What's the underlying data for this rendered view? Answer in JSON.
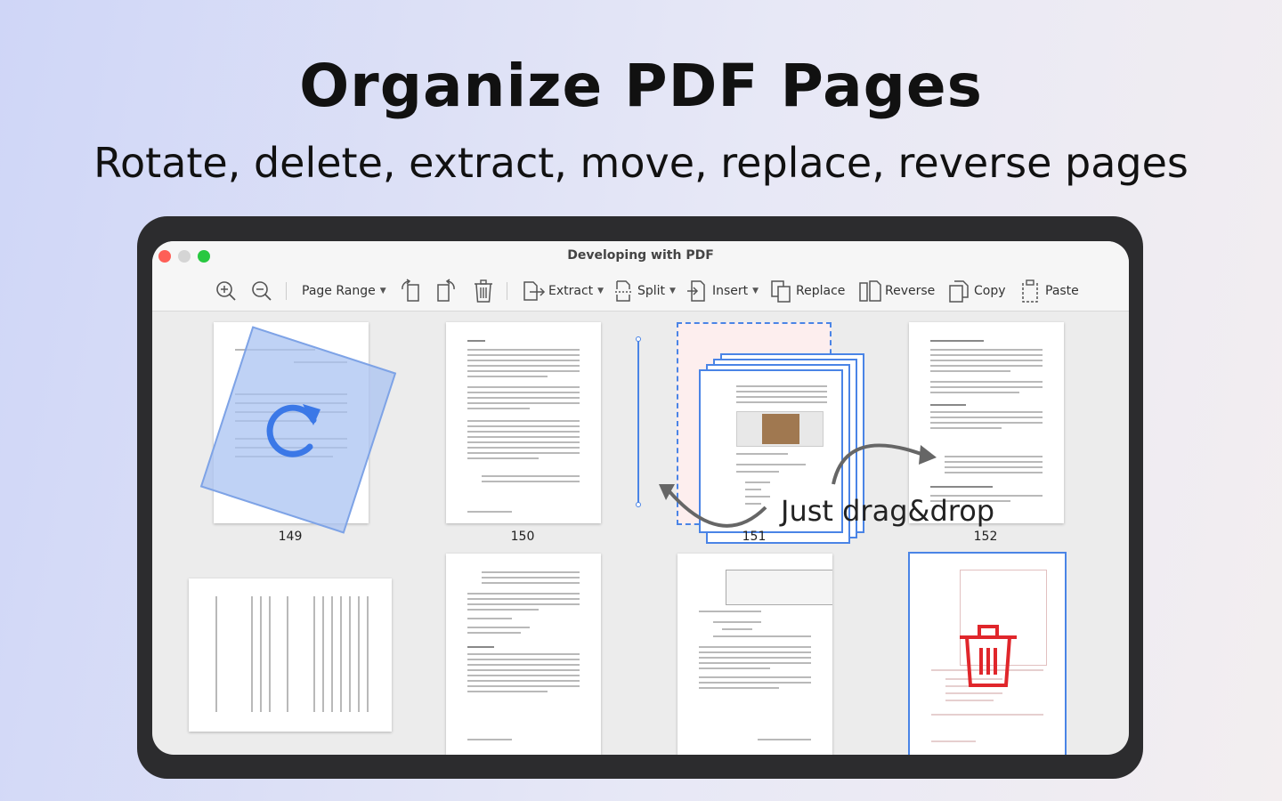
{
  "hero": {
    "title": "Organize PDF Pages",
    "subtitle": "Rotate, delete, extract, move, replace, reverse pages"
  },
  "window": {
    "title": "Developing with PDF"
  },
  "toolbar": {
    "page_range": "Page Range",
    "extract": "Extract",
    "split": "Split",
    "insert": "Insert",
    "replace": "Replace",
    "reverse": "Reverse",
    "copy": "Copy",
    "paste": "Paste"
  },
  "pages": {
    "p149": "149",
    "p150": "150",
    "p151": "151",
    "p152": "152"
  },
  "annotation": {
    "drag_text": "Just drag&drop"
  },
  "colors": {
    "accent": "#3b78e7",
    "delete": "#e0262b",
    "rotate_overlay": "#a9c3f2"
  },
  "icons": {
    "zoom_in": "zoom-in-icon",
    "zoom_out": "zoom-out-icon",
    "rotate_left": "rotate-left-icon",
    "rotate_right": "rotate-right-icon",
    "delete": "trash-icon",
    "rotate_overlay": "rotate-arrow-icon",
    "delete_overlay": "trash-icon"
  }
}
